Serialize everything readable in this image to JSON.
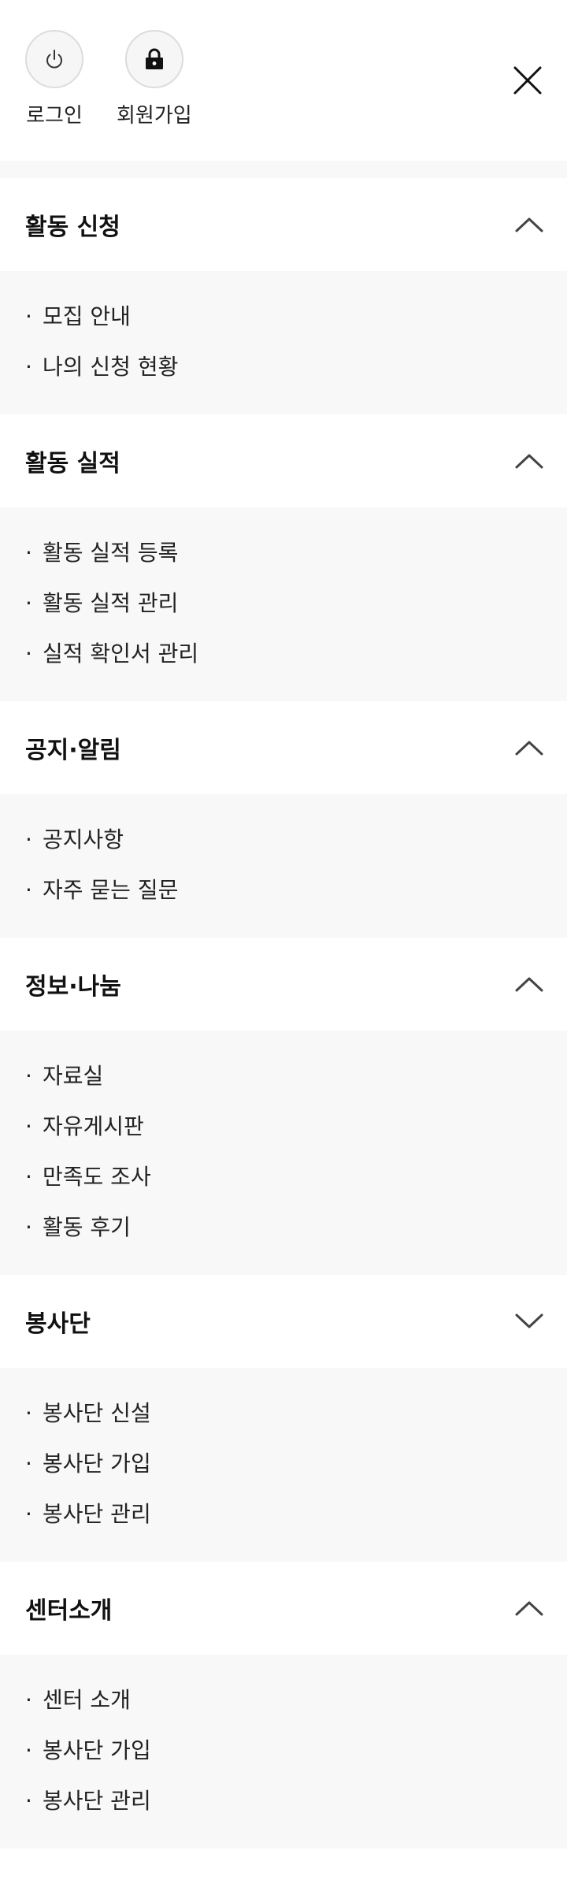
{
  "header": {
    "login_label": "로그인",
    "signup_label": "회원가입"
  },
  "bullet": "·",
  "sections": [
    {
      "title": "활동 신청",
      "expanded": true,
      "items": [
        "모집 안내",
        "나의 신청 현황"
      ]
    },
    {
      "title": "활동 실적",
      "expanded": true,
      "items": [
        "활동 실적 등록",
        "활동 실적 관리",
        "실적 확인서 관리"
      ]
    },
    {
      "title": "공지·알림",
      "expanded": true,
      "items": [
        "공지사항",
        "자주 묻는 질문"
      ]
    },
    {
      "title": "정보·나눔",
      "expanded": true,
      "items": [
        "자료실",
        "자유게시판",
        "만족도 조사",
        "활동 후기"
      ]
    },
    {
      "title": "봉사단",
      "expanded": false,
      "items": [
        "봉사단 신설",
        "봉사단 가입",
        "봉사단 관리"
      ]
    },
    {
      "title": "센터소개",
      "expanded": true,
      "items": [
        "센터 소개",
        "봉사단 가입",
        "봉사단 관리"
      ]
    }
  ]
}
